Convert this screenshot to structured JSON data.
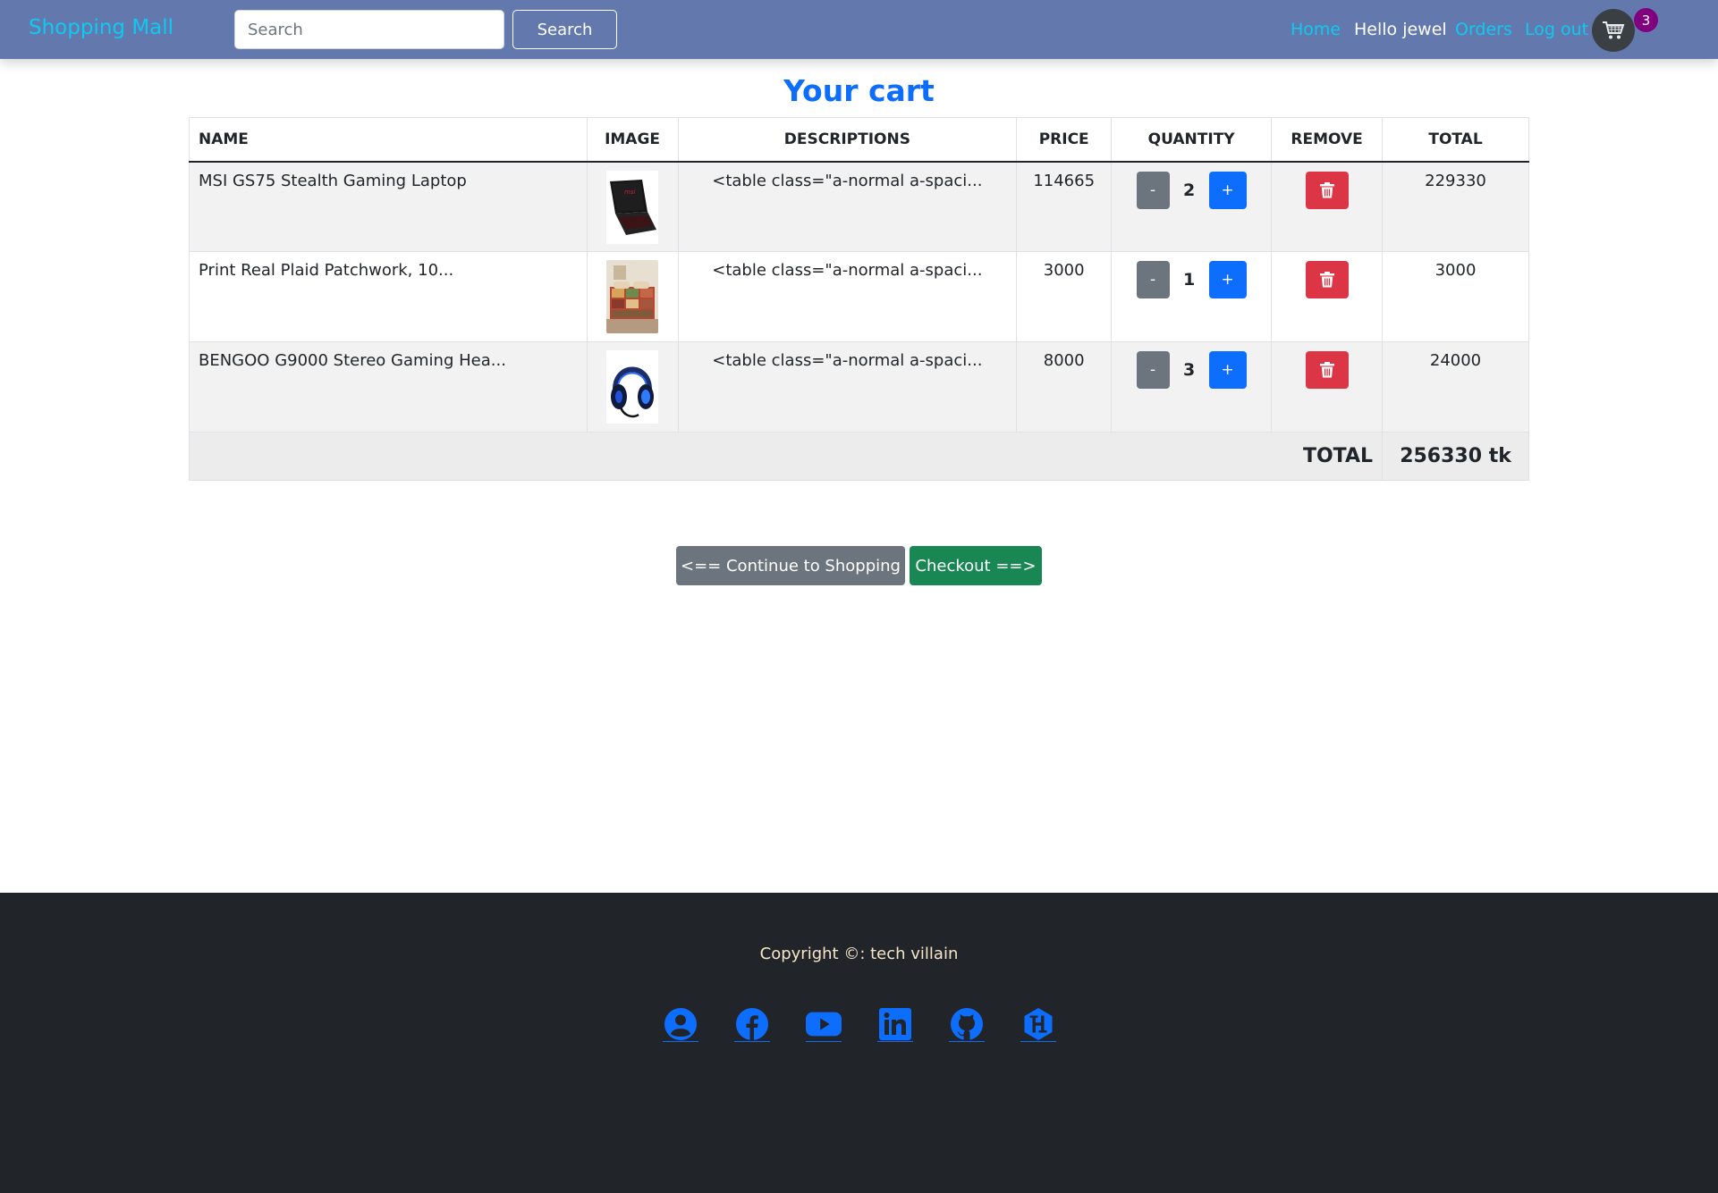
{
  "navbar": {
    "brand": "Shopping Mall",
    "search_placeholder": "Search",
    "search_button": "Search",
    "home_link": "Home",
    "greeting": "Hello jewel",
    "orders_link": "Orders",
    "logout_link": "Log out",
    "cart_icon": "shopping-cart-icon",
    "cart_count": "3"
  },
  "cart": {
    "title": "Your cart",
    "headers": {
      "name": "NAME",
      "image": "IMAGE",
      "descriptions": "DESCRIPTIONS",
      "price": "PRICE",
      "quantity": "QUANTITY",
      "remove": "REMOVE",
      "total": "TOTAL"
    },
    "items": [
      {
        "name": "MSI GS75 Stealth Gaming Laptop",
        "image_icon": "laptop-thumbnail",
        "description": "<table class=\"a-normal a-spaci...",
        "price": "114665",
        "minus": "-",
        "quantity": "2",
        "plus": "+",
        "total": "229330"
      },
      {
        "name": "Print Real Plaid Patchwork, 10...",
        "image_icon": "bedding-thumbnail",
        "description": "<table class=\"a-normal a-spaci...",
        "price": "3000",
        "minus": "-",
        "quantity": "1",
        "plus": "+",
        "total": "3000"
      },
      {
        "name": "BENGOO G9000 Stereo Gaming Hea...",
        "image_icon": "headset-thumbnail",
        "description": "<table class=\"a-normal a-spaci...",
        "price": "8000",
        "minus": "-",
        "quantity": "3",
        "plus": "+",
        "total": "24000"
      }
    ],
    "total_label": "TOTAL",
    "grand_total": "256330 tk"
  },
  "actions": {
    "continue_label": "<== Continue to Shopping",
    "checkout_label": "Checkout ==>"
  },
  "footer": {
    "copyright": "Copyright ©: tech villain",
    "social_icons": [
      "user-circle-icon",
      "facebook-icon",
      "youtube-icon",
      "linkedin-icon",
      "github-icon",
      "hashnode-icon"
    ]
  },
  "colors": {
    "navbar_bg": "#6379ae",
    "brand": "#0dcaf0",
    "primary": "#0d6efd",
    "danger": "#dc3545",
    "success": "#198754",
    "secondary": "#6c757d",
    "footer_bg": "#212529",
    "badge": "#800080"
  }
}
